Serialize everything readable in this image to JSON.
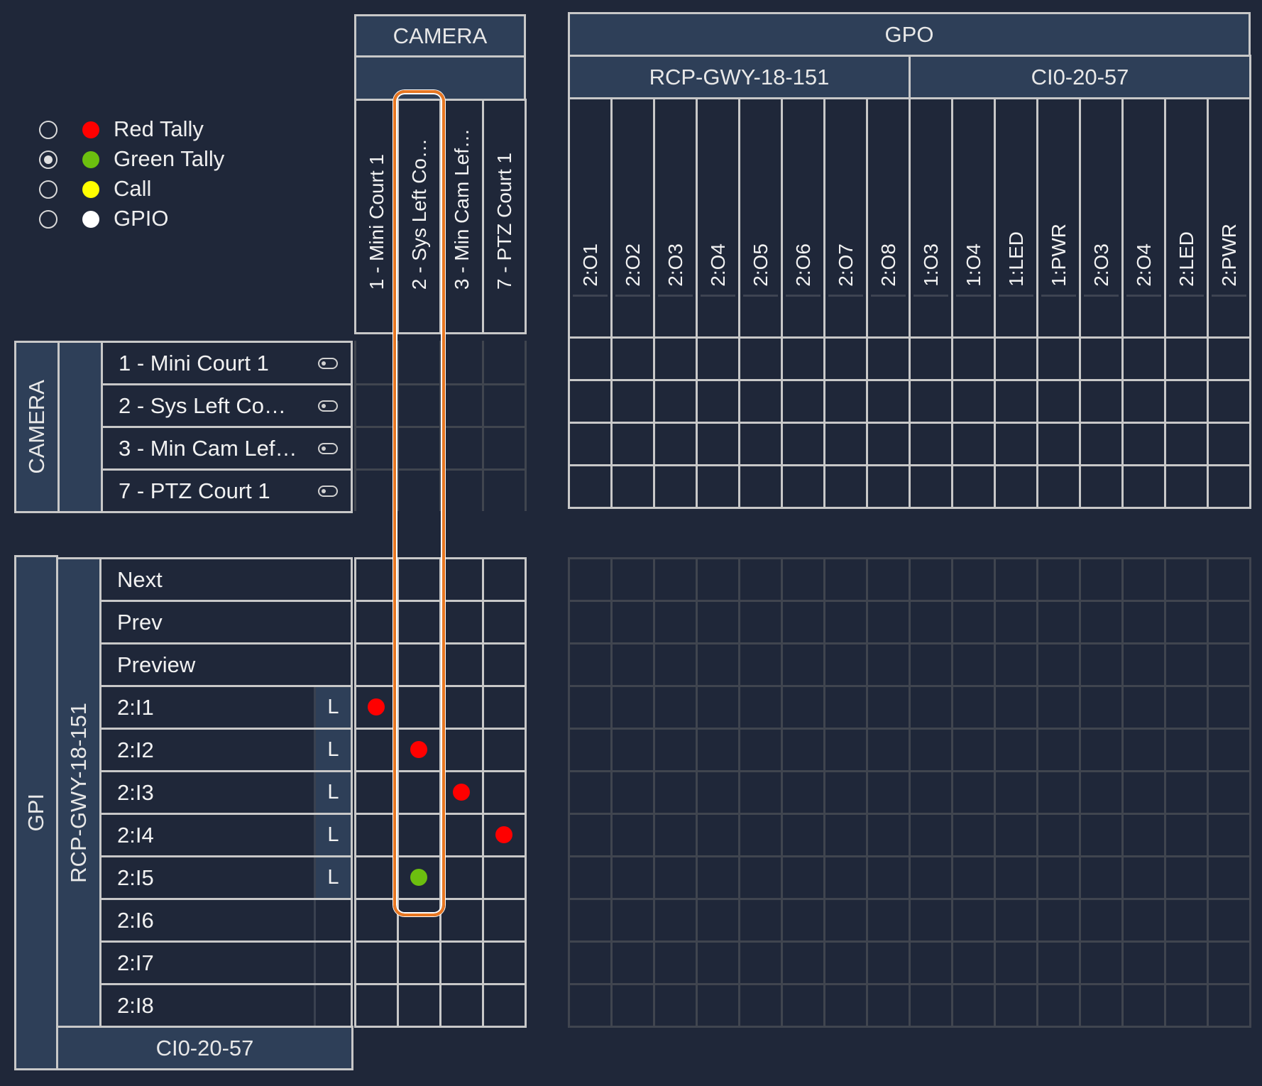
{
  "colors": {
    "background": "#1f2739",
    "header": "#2e3f58",
    "border": "#c8c8c8",
    "grid_dim": "#40454f",
    "highlight": "#e87722",
    "red": "#ff0000",
    "green": "#6cbf0f",
    "yellow": "#ffff00",
    "white": "#ffffff"
  },
  "legend": [
    {
      "label": "Red Tally",
      "color": "#ff0000",
      "selected": false
    },
    {
      "label": "Green Tally",
      "color": "#6cbf0f",
      "selected": true
    },
    {
      "label": "Call",
      "color": "#ffff00",
      "selected": false
    },
    {
      "label": "GPIO",
      "color": "#ffffff",
      "selected": false
    }
  ],
  "camera_cols": {
    "title": "CAMERA",
    "subtitle": "",
    "columns": [
      "1 - Mini Court 1",
      "2 - Sys Left Co…",
      "3 - Min Cam Lef…",
      "7 - PTZ Court 1"
    ],
    "highlighted_column": 1
  },
  "gpo": {
    "title": "GPO",
    "groups": [
      {
        "name": "RCP-GWY-18-151",
        "columns": [
          "2:O1",
          "2:O2",
          "2:O3",
          "2:O4",
          "2:O5",
          "2:O6",
          "2:O7",
          "2:O8"
        ]
      },
      {
        "name": "CI0-20-57",
        "columns": [
          "1:O3",
          "1:O4",
          "1:LED",
          "1:PWR",
          "2:O3",
          "2:O4",
          "2:LED",
          "2:PWR"
        ]
      }
    ]
  },
  "camera_rows": {
    "title": "CAMERA",
    "rows": [
      "1 - Mini Court 1",
      "2 - Sys Left Co…",
      "3 - Min Cam Lef…",
      "7 - PTZ Court 1"
    ],
    "icon": "toggle-icon"
  },
  "gpi": {
    "title": "GPI",
    "group": "RCP-GWY-18-151",
    "footer_group": "CI0-20-57",
    "rows": [
      {
        "label": "Next",
        "lock": null
      },
      {
        "label": "Prev",
        "lock": null
      },
      {
        "label": "Preview",
        "lock": null
      },
      {
        "label": "2:I1",
        "lock": "L"
      },
      {
        "label": "2:I2",
        "lock": "L"
      },
      {
        "label": "2:I3",
        "lock": "L"
      },
      {
        "label": "2:I4",
        "lock": "L"
      },
      {
        "label": "2:I5",
        "lock": "L"
      },
      {
        "label": "2:I6",
        "lock": ""
      },
      {
        "label": "2:I7",
        "lock": ""
      },
      {
        "label": "2:I8",
        "lock": ""
      }
    ]
  },
  "crosspoints": [
    {
      "row": 3,
      "col": 0,
      "type": "red"
    },
    {
      "row": 4,
      "col": 1,
      "type": "red"
    },
    {
      "row": 5,
      "col": 2,
      "type": "red"
    },
    {
      "row": 6,
      "col": 3,
      "type": "red"
    },
    {
      "row": 7,
      "col": 1,
      "type": "green"
    }
  ]
}
